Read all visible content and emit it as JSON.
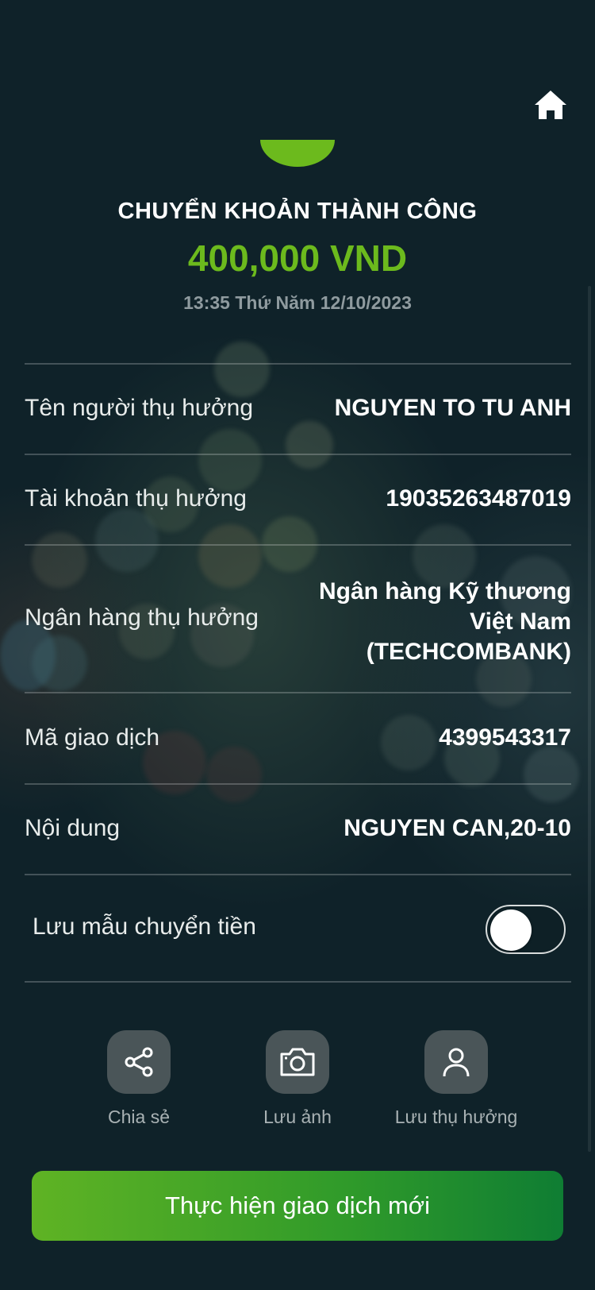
{
  "header": {
    "home_icon": "home-icon"
  },
  "result": {
    "status_title": "CHUYỂN KHOẢN THÀNH CÔNG",
    "amount": "400,000 VND",
    "datetime": "13:35 Thứ Năm 12/10/2023",
    "accent_color": "#6cba1d"
  },
  "details": [
    {
      "label": "Tên người thụ hưởng",
      "value": "NGUYEN TO TU ANH"
    },
    {
      "label": "Tài khoản thụ hưởng",
      "value": "19035263487019"
    },
    {
      "label": "Ngân hàng thụ hưởng",
      "value_lines": [
        "Ngân hàng Kỹ thương",
        "Việt Nam",
        "(TECHCOMBANK)"
      ]
    },
    {
      "label": "Mã giao dịch",
      "value": "4399543317"
    },
    {
      "label": "Nội dung",
      "value": "NGUYEN CAN,20-10"
    }
  ],
  "save_template": {
    "label": "Lưu mẫu chuyển tiền",
    "enabled": false
  },
  "actions": [
    {
      "icon": "share-icon",
      "label": "Chia sẻ"
    },
    {
      "icon": "camera-icon",
      "label": "Lưu ảnh"
    },
    {
      "icon": "user-icon",
      "label": "Lưu thụ hưởng"
    }
  ],
  "primary_button": {
    "label": "Thực hiện giao dịch mới"
  }
}
